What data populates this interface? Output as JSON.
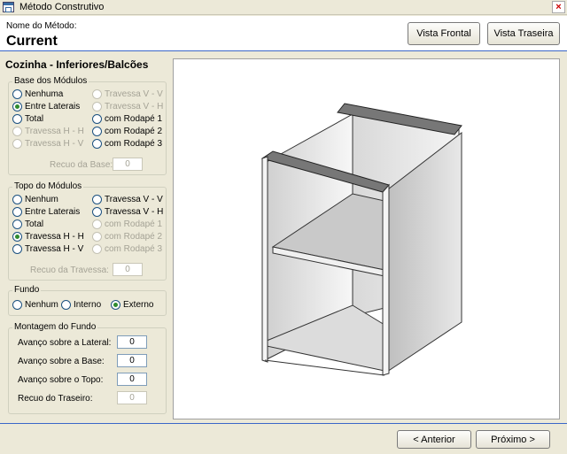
{
  "window": {
    "title": "Método Construtivo",
    "close_glyph": "×"
  },
  "header": {
    "method_label": "Nome do Método:",
    "method_value": "Current"
  },
  "toolbar": {
    "vista_frontal": "Vista Frontal",
    "vista_traseira": "Vista Traseira"
  },
  "section": {
    "title": "Cozinha - Inferiores/Balcões"
  },
  "base": {
    "legend": "Base dos Módulos",
    "options": {
      "nenhuma": "Nenhuma",
      "entre_laterais": "Entre Laterais",
      "total": "Total",
      "travessa_hh": "Travessa H - H",
      "travessa_hv": "Travessa H - V",
      "travessa_vv": "Travessa V - V",
      "travessa_vh": "Travessa V - H",
      "rodape1": "com Rodapé 1",
      "rodape2": "com Rodapé 2",
      "rodape3": "com Rodapé 3"
    },
    "selected": "Entre Laterais",
    "recuo_label": "Recuo da Base:",
    "recuo_value": "0"
  },
  "topo": {
    "legend": "Topo do Módulos",
    "options": {
      "nenhum": "Nenhum",
      "entre_laterais": "Entre Laterais",
      "total": "Total",
      "travessa_hh": "Travessa H - H",
      "travessa_hv": "Travessa H - V",
      "travessa_vv": "Travessa V - V",
      "travessa_vh": "Travessa V - H",
      "rodape1": "com Rodapé 1",
      "rodape2": "com Rodapé 2",
      "rodape3": "com Rodapé 3"
    },
    "selected": "Travessa H - H",
    "recuo_label": "Recuo da Travessa:",
    "recuo_value": "0"
  },
  "fundo": {
    "legend": "Fundo",
    "options": {
      "nenhum": "Nenhum",
      "interno": "Interno",
      "externo": "Externo"
    },
    "selected": "Externo"
  },
  "montagem": {
    "legend": "Montagem do Fundo",
    "fields": {
      "lateral_label": "Avanço sobre a Lateral:",
      "lateral_value": "0",
      "base_label": "Avanço sobre a Base:",
      "base_value": "0",
      "topo_label": "Avanço sobre o Topo:",
      "topo_value": "0",
      "traseiro_label": "Recuo do Traseiro:",
      "traseiro_value": "0"
    }
  },
  "footer": {
    "anterior": "< Anterior",
    "proximo": "Próximo >"
  },
  "colors": {
    "accent": "#3a66c8",
    "radio_check": "#2e8b2e",
    "window_bg": "#ece9d8"
  }
}
